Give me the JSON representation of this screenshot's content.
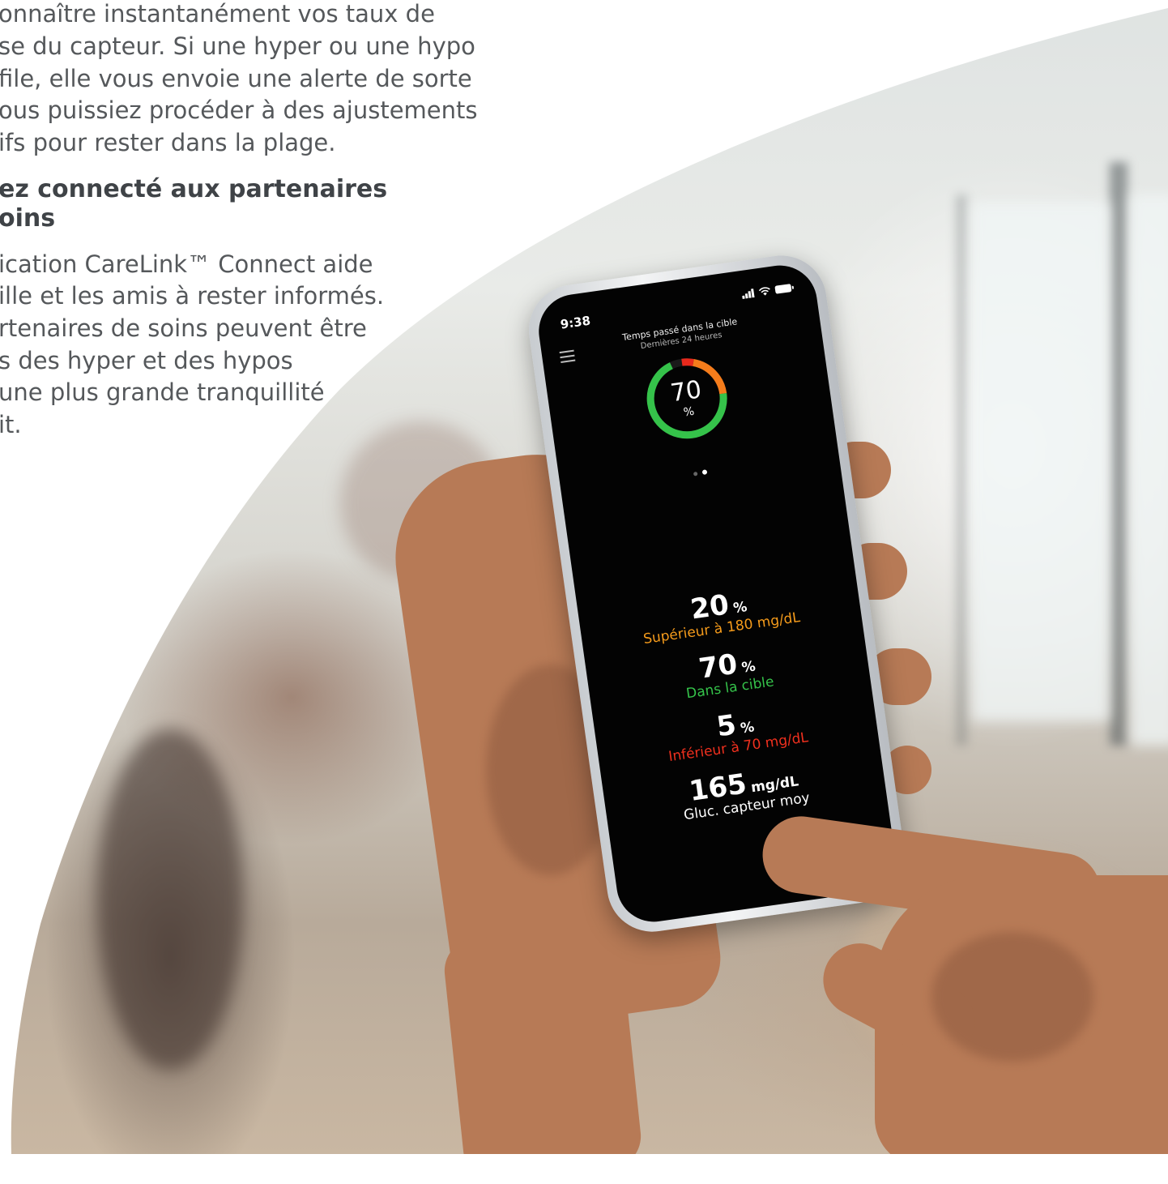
{
  "article": {
    "paragraph1_lines": [
      "onnaître instantanément vos taux de",
      "se du capteur. Si une hyper ou une hypo",
      "file, elle vous envoie une alerte de sorte",
      "ous puissiez procéder à des ajustements",
      "ifs pour rester dans la plage."
    ],
    "heading_lines": [
      "ez connecté aux partenaires",
      "oins"
    ],
    "paragraph2_lines": [
      "ication CareLink™ Connect aide",
      "ille et les amis à rester informés.",
      "rtenaires de soins peuvent être",
      "s des hyper et des hypos",
      "une plus grande tranquillité",
      "it."
    ]
  },
  "phone": {
    "status_time": "9:38",
    "status_icons": [
      "cellular-signal-icon",
      "wifi-icon",
      "battery-icon"
    ],
    "menu_icon": "hamburger-menu-icon",
    "screen_title": "Temps passé dans la cible",
    "screen_subtitle": "Dernières 24 heures",
    "ring": {
      "value": "70",
      "unit": "%",
      "segments": [
        {
          "name": "dans la cible",
          "percent": 70,
          "color": "#35c24a"
        },
        {
          "name": "supérieur",
          "percent": 20,
          "color": "#f57c1b"
        },
        {
          "name": "inférieur",
          "percent": 5,
          "color": "#e8291c"
        }
      ]
    },
    "page_dots": {
      "count": 2,
      "active": 1
    },
    "stats": [
      {
        "value": "20",
        "unit": "%",
        "label": "Supérieur à 180 mg/dL",
        "color": "#f59b1b"
      },
      {
        "value": "70",
        "unit": "%",
        "label": "Dans la cible",
        "color": "#35c24a"
      },
      {
        "value": "5",
        "unit": "%",
        "label": "Inférieur à 70 mg/dL",
        "color": "#f0301e"
      },
      {
        "value": "165",
        "unit": "mg/dL",
        "label": "Gluc. capteur moy",
        "color": "#ffffff"
      }
    ]
  }
}
